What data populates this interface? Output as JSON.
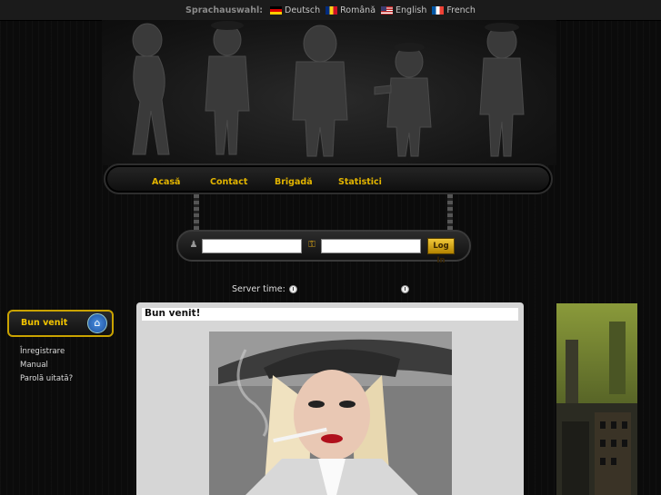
{
  "topbar": {
    "label": "Sprachauswahl:",
    "languages": [
      {
        "name": "Deutsch",
        "flag": "de"
      },
      {
        "name": "Română",
        "flag": "ro"
      },
      {
        "name": "English",
        "flag": "en"
      },
      {
        "name": "French",
        "flag": "fr"
      }
    ]
  },
  "nav": {
    "items": [
      "Acasă",
      "Contact",
      "Brigadă",
      "Statistici"
    ]
  },
  "login": {
    "button": "Log In",
    "user_icon": "user-icon",
    "key_icon": "key-icon"
  },
  "server": {
    "label": "Server time:",
    "time": "",
    "date": ""
  },
  "sidebar": {
    "welcome": "Bun venit",
    "links": [
      "Înregistrare",
      "Manual",
      "Parolă uitată?"
    ]
  },
  "content": {
    "title": "Bun venit!"
  },
  "colors": {
    "accent": "#e2b400",
    "background": "#0b0b0b",
    "content_bg": "#d6d6d6"
  }
}
